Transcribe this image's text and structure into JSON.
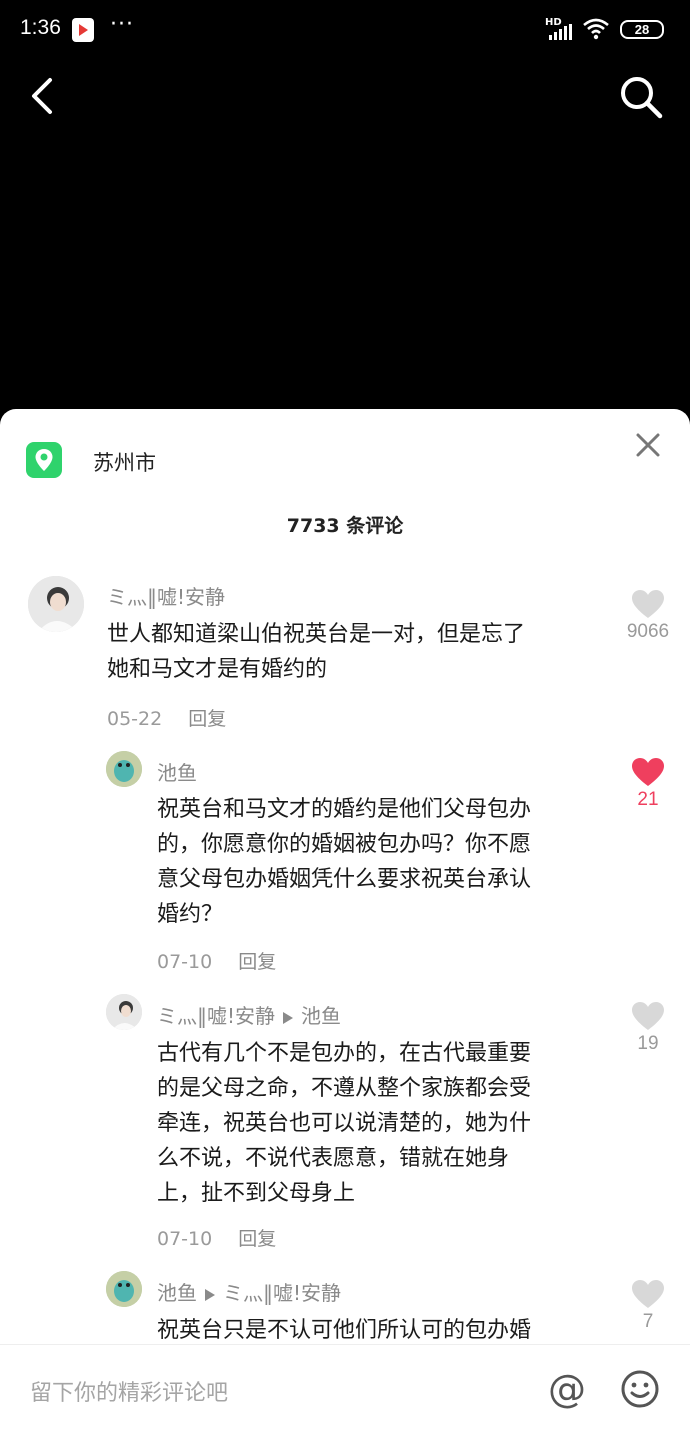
{
  "status_bar": {
    "time": "1:36",
    "dots": "···",
    "hd": "HD",
    "battery": "28"
  },
  "sheet": {
    "location": "苏州市",
    "comment_count": "7733 条评论",
    "comments": [
      {
        "user": "ミ灬‖嘘!安静",
        "text_lines": [
          "世人都知道梁山伯祝英台是一对，但是忘了",
          "她和马文才是有婚约的"
        ],
        "date": "05-22",
        "reply": "回复",
        "likes": "9066"
      },
      {
        "user": "池鱼",
        "text_lines": [
          "祝英台和马文才的婚约是他们父母包办",
          "的，你愿意你的婚姻被包办吗？你不愿",
          "意父母包办婚姻凭什么要求祝英台承认",
          "婚约？"
        ],
        "date": "07-10",
        "reply": "回复",
        "likes": "21"
      },
      {
        "user": "ミ灬‖嘘!安静",
        "reply_to": "池鱼",
        "text_lines": [
          "古代有几个不是包办的，在古代最重要",
          "的是父母之命，不遵从整个家族都会受",
          "牵连，祝英台也可以说清楚的，她为什",
          "么不说，不说代表愿意，错就在她身",
          "上，扯不到父母身上"
        ],
        "date": "07-10",
        "reply": "回复",
        "likes": "19"
      },
      {
        "user": "池鱼",
        "reply_to": "ミ灬‖嘘!安静",
        "text_lines": [
          "祝英台只是不认可他们所认可的包办婚"
        ],
        "likes": "7"
      }
    ]
  },
  "input": {
    "placeholder": "留下你的精彩评论吧",
    "at": "@"
  },
  "colors": {
    "accent_like": "#ef3f5e",
    "location_green": "#2fd36c"
  }
}
